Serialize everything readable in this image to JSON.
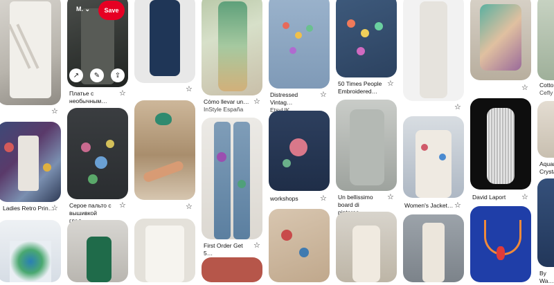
{
  "hover": {
    "board": "M.",
    "save_label": "Save",
    "icons": [
      "arrow-up-right-icon",
      "pencil-icon",
      "share-icon"
    ]
  },
  "pins": [
    {
      "id": "p1",
      "title": "",
      "source": ""
    },
    {
      "id": "p2",
      "title": "Ladies Retro Prin…",
      "source": ""
    },
    {
      "id": "p3",
      "title": "",
      "source": ""
    },
    {
      "id": "p4",
      "title": "Платье с необычным…",
      "source": ""
    },
    {
      "id": "p5",
      "title": "Серое пальто с вышивкой глад…",
      "source": ""
    },
    {
      "id": "p6",
      "title": "",
      "source": ""
    },
    {
      "id": "p7",
      "title": "",
      "source": ""
    },
    {
      "id": "p8",
      "title": "",
      "source": ""
    },
    {
      "id": "p9",
      "title": "",
      "source": ""
    },
    {
      "id": "p10",
      "title": "Cómo llevar un…",
      "source": "InStyle España"
    },
    {
      "id": "p11",
      "title": "First Order Get 5…",
      "source": ""
    },
    {
      "id": "p12",
      "title": "",
      "source": ""
    },
    {
      "id": "p13",
      "title": "Distressed Vintag…",
      "source": "EtsyUK"
    },
    {
      "id": "p14",
      "title": "workshops",
      "source": ""
    },
    {
      "id": "p15",
      "title": "",
      "source": ""
    },
    {
      "id": "p16",
      "title": "50 Times People Embroidered…",
      "source": ""
    },
    {
      "id": "p17",
      "title": "Un bellissimo board di pinteres…",
      "source": ""
    },
    {
      "id": "p18",
      "title": "",
      "source": ""
    },
    {
      "id": "p19",
      "title": "",
      "source": ""
    },
    {
      "id": "p20",
      "title": "Women's Jacket…",
      "source": ""
    },
    {
      "id": "p21",
      "title": "",
      "source": ""
    },
    {
      "id": "p22",
      "title": "",
      "source": ""
    },
    {
      "id": "p23",
      "title": "David Laport",
      "source": ""
    },
    {
      "id": "p24",
      "title": "",
      "source": ""
    },
    {
      "id": "p25",
      "title": "Cotto…",
      "source": "Cefly"
    },
    {
      "id": "p26",
      "title": "Aquar… Crysta…",
      "source": ""
    },
    {
      "id": "p27",
      "title": "By Wa…",
      "source": ""
    }
  ]
}
